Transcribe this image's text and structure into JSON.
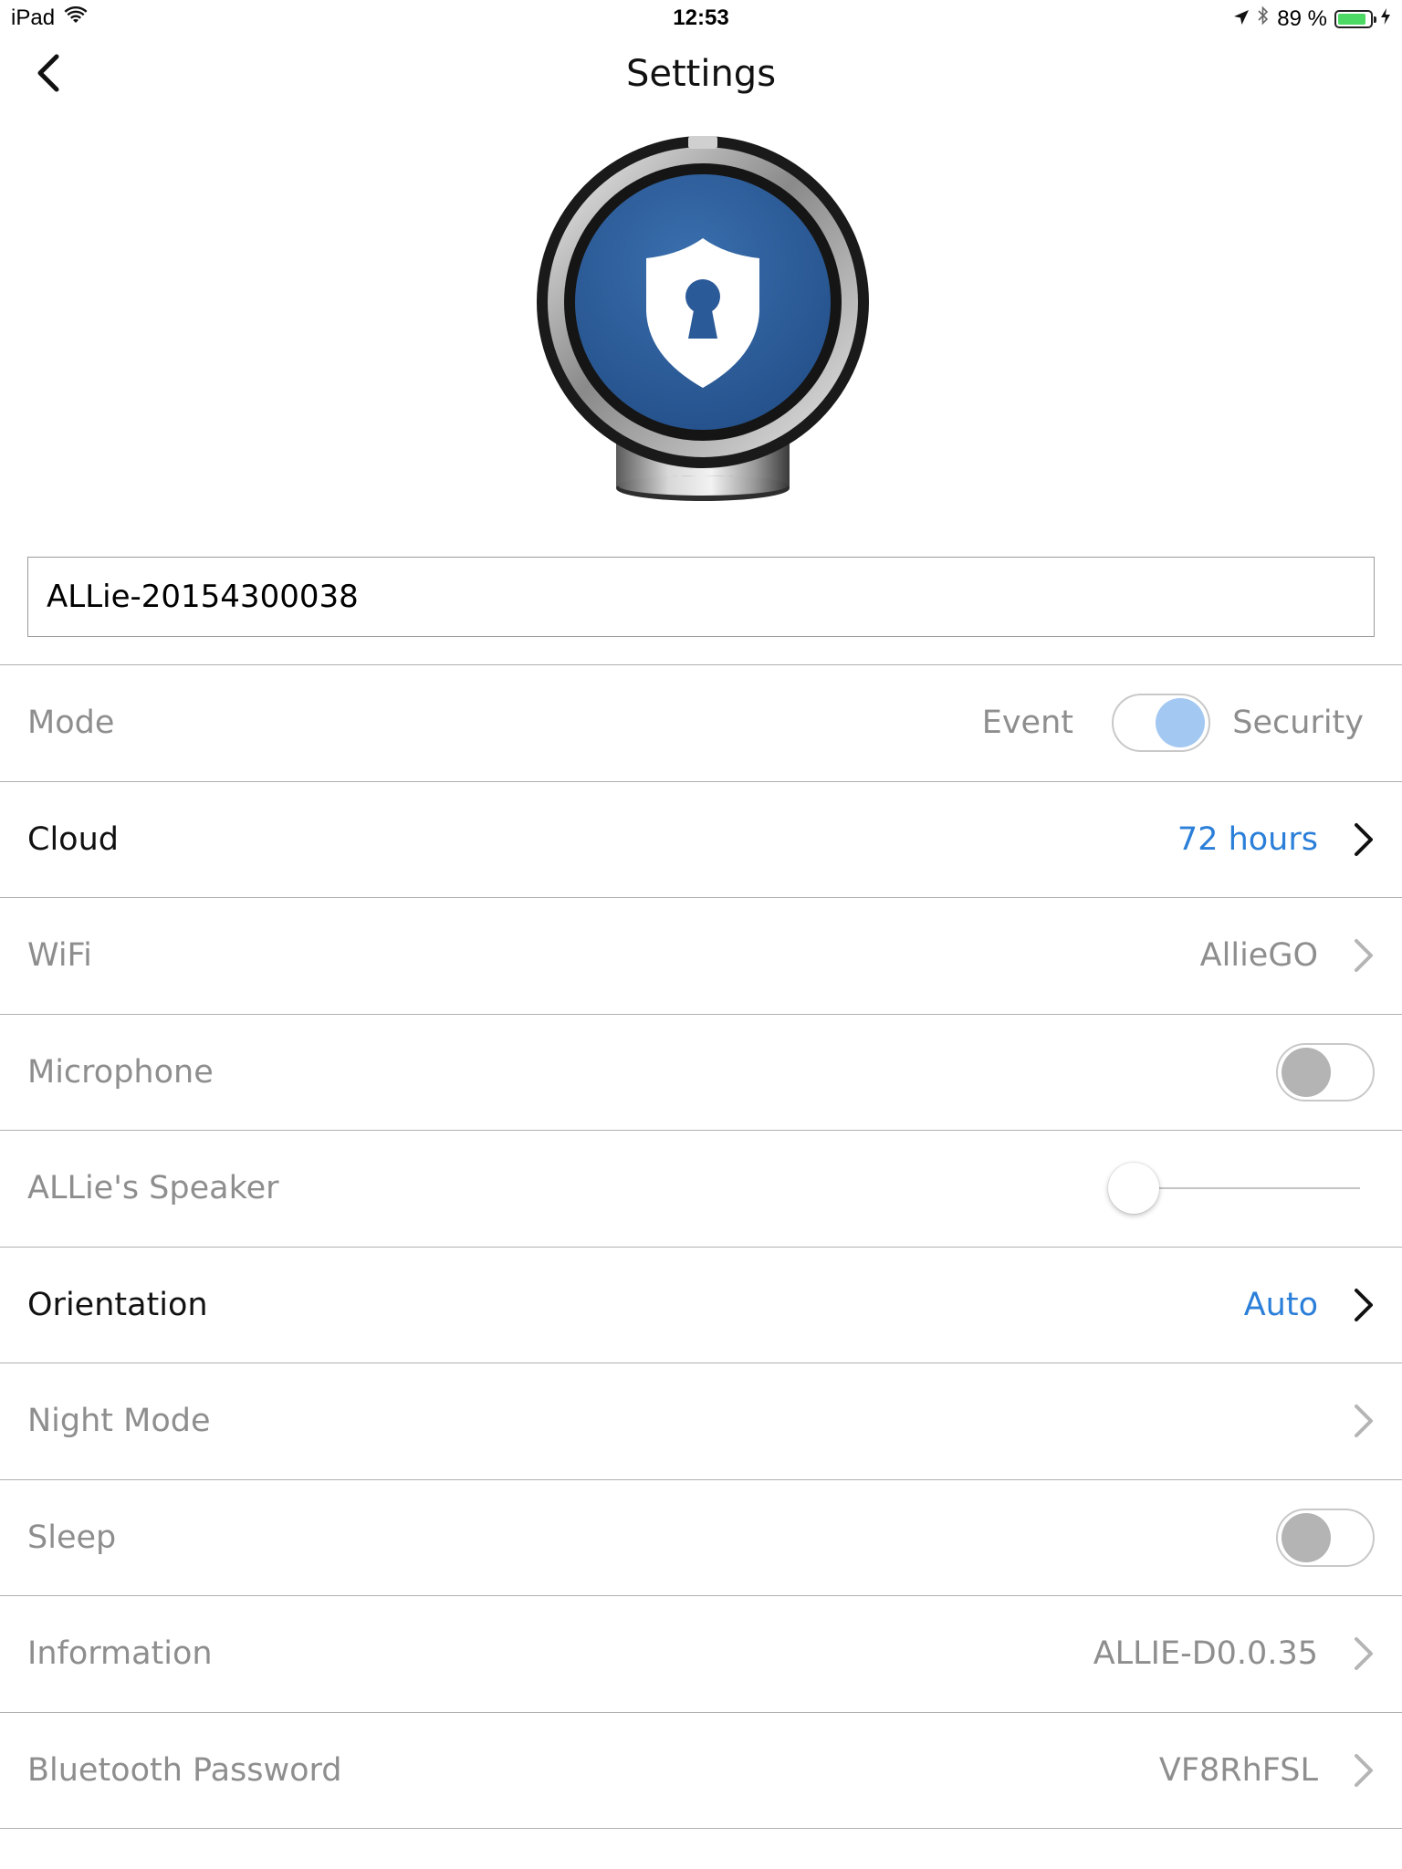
{
  "status_bar": {
    "device": "iPad",
    "time": "12:53",
    "battery_text": "89 %",
    "battery_level": 0.89
  },
  "nav": {
    "title": "Settings",
    "back_icon": "chevron-left-icon"
  },
  "device_image": {
    "icon": "shield-lock-icon",
    "accent": "#2f5f9e"
  },
  "device_name": {
    "value": "ALLie-20154300038"
  },
  "settings": {
    "mode": {
      "label": "Mode",
      "option_left": "Event",
      "option_right": "Security"
    },
    "cloud": {
      "label": "Cloud",
      "value": "72 hours"
    },
    "wifi": {
      "label": "WiFi",
      "value": "AllieGO"
    },
    "microphone": {
      "label": "Microphone",
      "on": false
    },
    "speaker": {
      "label": "ALLie's Speaker",
      "level": 0.08
    },
    "orientation": {
      "label": "Orientation",
      "value": "Auto"
    },
    "night_mode": {
      "label": "Night Mode"
    },
    "sleep": {
      "label": "Sleep",
      "on": false
    },
    "information": {
      "label": "Information",
      "value": "ALLIE-D0.0.35"
    },
    "bluetooth_password": {
      "label": "Bluetooth Password",
      "value": "VF8RhFSL"
    }
  },
  "colors": {
    "accent_blue": "#2b7fd9",
    "toggle_knob_mode": "#a3c8f2",
    "toggle_knob_off": "#b4b4b4",
    "battery_green": "#4cd964"
  }
}
